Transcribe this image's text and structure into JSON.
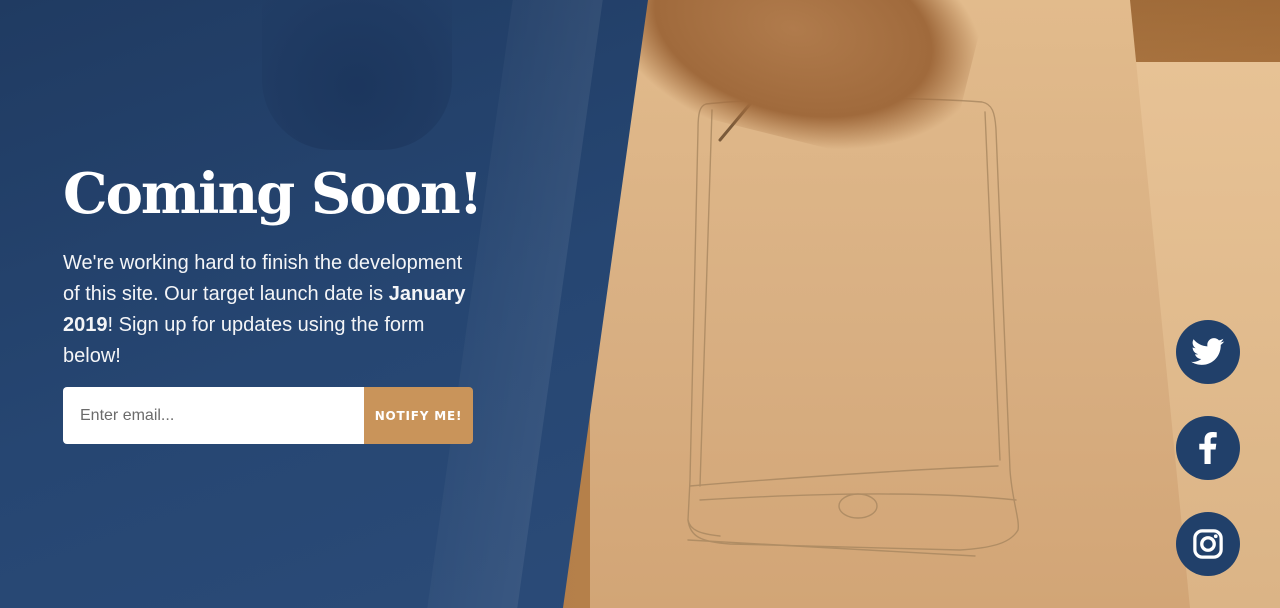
{
  "masthead": {
    "title": "Coming Soon!",
    "lead_part1": "We're working hard to finish the development of this site. Our target launch date is ",
    "lead_bold": "January 2019",
    "lead_part2": "! Sign up for updates using the form below!"
  },
  "signup": {
    "email_placeholder": "Enter email...",
    "email_value": "",
    "button_label": "NOTIFY ME!"
  },
  "social": [
    {
      "icon": "twitter-icon"
    },
    {
      "icon": "facebook-icon"
    },
    {
      "icon": "instagram-icon"
    }
  ],
  "colors": {
    "overlay_blue": "#264672",
    "accent_tan": "#c9945a",
    "social_circle": "#21406a",
    "text_white": "#ffffff"
  }
}
